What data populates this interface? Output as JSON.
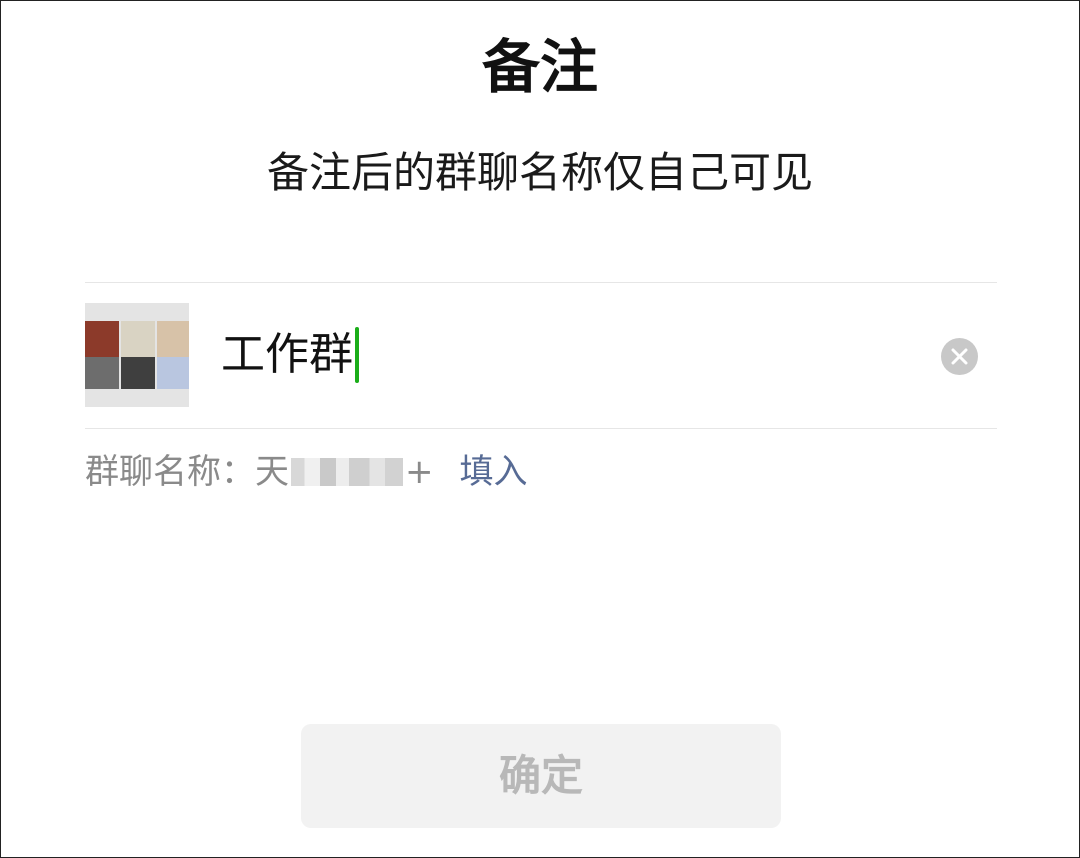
{
  "dialog": {
    "title": "备注",
    "subtitle": "备注后的群聊名称仅自己可见"
  },
  "remark_input": {
    "value": "工作群"
  },
  "group_name_hint": {
    "label": "群聊名称：",
    "name_prefix": "天",
    "name_suffix": "+",
    "fill_label": "填入"
  },
  "confirm_button": {
    "label": "确定"
  },
  "colors": {
    "caret": "#1aad19",
    "link": "#576b95",
    "clear_icon_bg": "#c8c8c8",
    "confirm_disabled_bg": "#f2f2f2",
    "confirm_disabled_text": "#b8b8b8"
  },
  "icons": {
    "avatar": "group-avatar-mosaic",
    "clear": "clear-x-circle-icon"
  }
}
